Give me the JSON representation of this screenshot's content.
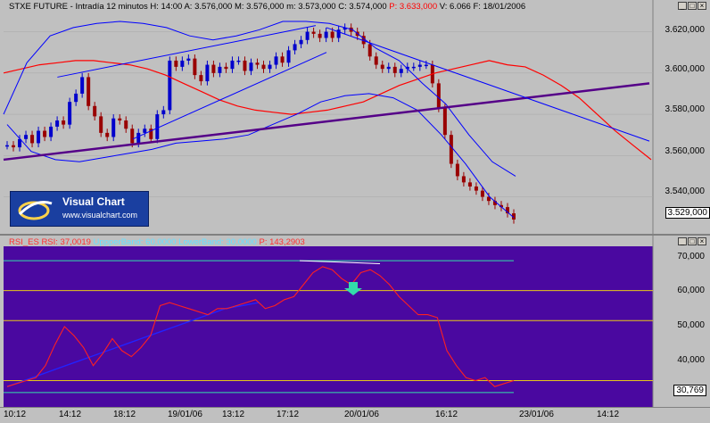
{
  "price_header": {
    "symbol": "STXE FUTURE",
    "interval": "Intradía 12 minutos",
    "high_label": "H: 14:00",
    "open": "A: 3.576,000",
    "max": "M: 3.576,000",
    "min": "m: 3.573,000",
    "close": "C: 3.574,000",
    "pct": "P: 3.633,000",
    "vol": "V: 6.066",
    "date": "F: 18/01/2006"
  },
  "rsi_header": {
    "name": "RSI_ES",
    "rsi_label": "RSI: 37,0019",
    "upper_label": "UppperBand: 60,0000",
    "lower_label": "LowerBand: 30,0000",
    "p_label": "P: 143,2903"
  },
  "price_axis_labels": [
    "3.620,000",
    "3.600,000",
    "3.580,000",
    "3.560,000",
    "3.540,000"
  ],
  "rsi_axis_labels": [
    "70,000",
    "60,000",
    "50,000",
    "40,000"
  ],
  "price_last": "3.529,000",
  "rsi_last": "30,769",
  "time_labels": [
    "10:12",
    "14:12",
    "18:12",
    "19/01/06",
    "13:12",
    "17:12",
    "20/01/06",
    "16:12",
    "23/01/06",
    "14:12"
  ],
  "logo": {
    "title": "Visual Chart",
    "url": "www.visualchart.com"
  },
  "window_buttons": {
    "minimize": "_",
    "maximize": "□",
    "close": "×"
  },
  "colors": {
    "price_bg": "#c0c0c0",
    "rsi_bg": "#4a08a0",
    "candle_up": "#0000cc",
    "candle_down": "#990000",
    "ma_red": "#ff0000",
    "band_blue": "#0000ff",
    "trend_purple": "#550088",
    "rsi_line": "#ff2020",
    "rsi_avg": "#2222ff",
    "arrow": "#33ddaa"
  },
  "chart_data": {
    "type": "line",
    "price": {
      "ylim": [
        3529,
        3625
      ],
      "close": [
        3565,
        3564,
        3568,
        3570,
        3566,
        3572,
        3569,
        3574,
        3577,
        3575,
        3586,
        3590,
        3598,
        3584,
        3579,
        3571,
        3569,
        3578,
        3577,
        3573,
        3566,
        3571,
        3573,
        3568,
        3580,
        3582,
        3606,
        3603,
        3606,
        3607,
        3599,
        3596,
        3604,
        3600,
        3603,
        3602,
        3606,
        3606,
        3601,
        3605,
        3604,
        3602,
        3604,
        3608,
        3605,
        3611,
        3614,
        3616,
        3620,
        3619,
        3617,
        3620,
        3617,
        3621,
        3622,
        3620,
        3618,
        3614,
        3608,
        3604,
        3602,
        3603,
        3600,
        3602,
        3603,
        3603,
        3604,
        3604,
        3595,
        3583,
        3570,
        3556,
        3550,
        3547,
        3545,
        3543,
        3540,
        3538,
        3536,
        3535,
        3532,
        3529
      ],
      "ma_red": [
        3600,
        3602,
        3604,
        3605,
        3606,
        3606,
        3605,
        3604,
        3602,
        3599,
        3595,
        3591,
        3587,
        3584,
        3582,
        3581,
        3580,
        3581,
        3582,
        3584,
        3586,
        3590,
        3594,
        3597,
        3600,
        3602,
        3604,
        3606,
        3604,
        3603,
        3599,
        3594,
        3588,
        3580,
        3572,
        3565,
        3558
      ],
      "band_upper": [
        3580,
        3605,
        3618,
        3622,
        3624,
        3625,
        3624,
        3622,
        3618,
        3616,
        3618,
        3621,
        3625,
        3625,
        3624,
        3621,
        3612,
        3606,
        3595,
        3585,
        3570,
        3557,
        3550
      ],
      "band_lower": [
        3575,
        3562,
        3558,
        3557,
        3559,
        3561,
        3563,
        3566,
        3567,
        3568,
        3570,
        3575,
        3580,
        3586,
        3589,
        3590,
        3588,
        3582,
        3570,
        3556,
        3540,
        3530
      ],
      "trendlines": [
        {
          "from": [
            0,
            3558
          ],
          "to": [
            120,
            3595
          ]
        },
        {
          "from": [
            10,
            3598
          ],
          "to": [
            58,
            3623
          ]
        },
        {
          "from": [
            24,
            3568
          ],
          "to": [
            60,
            3610
          ]
        },
        {
          "from": [
            60,
            3622
          ],
          "to": [
            120,
            3567
          ]
        }
      ]
    },
    "rsi": {
      "ylim": [
        23,
        73
      ],
      "upper_band": 60,
      "lower_band": 30,
      "values": [
        28,
        29,
        30,
        31,
        35,
        42,
        48,
        45,
        41,
        35,
        39,
        44,
        40,
        38,
        41,
        45,
        55,
        56,
        55,
        54,
        53,
        52,
        54,
        54,
        55,
        56,
        57,
        54,
        55,
        57,
        58,
        62,
        66,
        68,
        67,
        64,
        62,
        66,
        67,
        65,
        62,
        58,
        55,
        52,
        52,
        51,
        40,
        35,
        31,
        30,
        31,
        28,
        29,
        30
      ],
      "avg": [
        28,
        30,
        32,
        34,
        36,
        38,
        40,
        42,
        44,
        46,
        48,
        50,
        52,
        54,
        55,
        56
      ]
    }
  }
}
